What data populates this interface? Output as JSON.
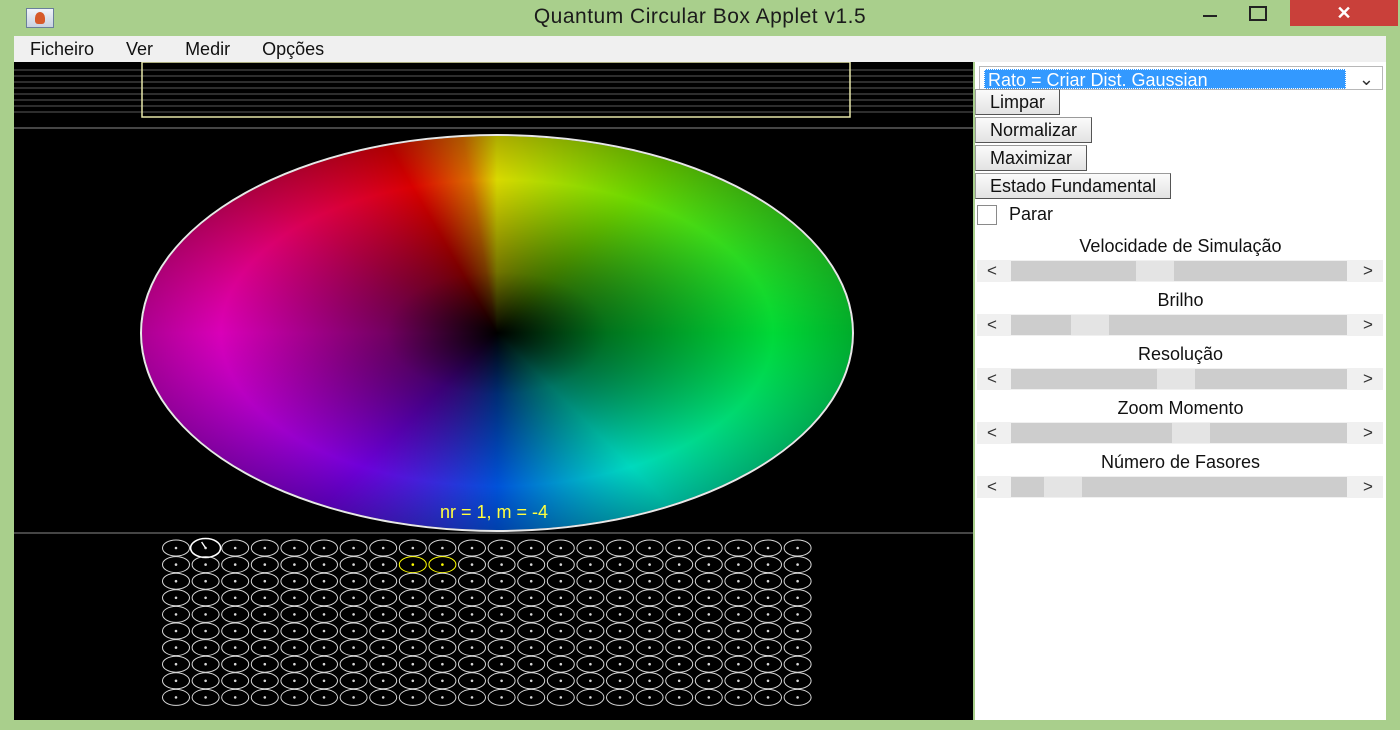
{
  "window": {
    "title": "Quantum Circular Box Applet v1.5",
    "close_glyph": "✕"
  },
  "menu": [
    {
      "label": "Ficheiro"
    },
    {
      "label": "Ver"
    },
    {
      "label": "Medir"
    },
    {
      "label": "Opções"
    }
  ],
  "canvas": {
    "state_label": "nr = 1, m = -4",
    "wheel_colors": [
      "#ffff00",
      "#00ff40",
      "#00ffe0",
      "#0060ff",
      "#ff00d8",
      "#ff0000"
    ],
    "phasor_grid": {
      "rows": 10,
      "cols": 22,
      "highlighted": [
        {
          "row": 1,
          "col": 8
        },
        {
          "row": 1,
          "col": 9
        }
      ],
      "selected": {
        "row": 0,
        "col": 1
      },
      "circle_color": "#d8d8d8",
      "highlight_color": "#ffff00"
    }
  },
  "panel": {
    "mouse_mode": "Rato = Criar Dist. Gaussian",
    "buttons": {
      "clear": "Limpar",
      "normalize": "Normalizar",
      "maximize": "Maximizar",
      "ground_state": "Estado Fundamental"
    },
    "stop_label": "Parar",
    "stop_checked": false,
    "sliders": [
      {
        "label": "Velocidade de Simulação",
        "value": 0.42
      },
      {
        "label": "Brilho",
        "value": 0.2
      },
      {
        "label": "Resolução",
        "value": 0.49
      },
      {
        "label": "Zoom Momento",
        "value": 0.54
      },
      {
        "label": "Número de Fasores",
        "value": 0.11
      }
    ],
    "arrow_left": "<",
    "arrow_right": ">"
  }
}
